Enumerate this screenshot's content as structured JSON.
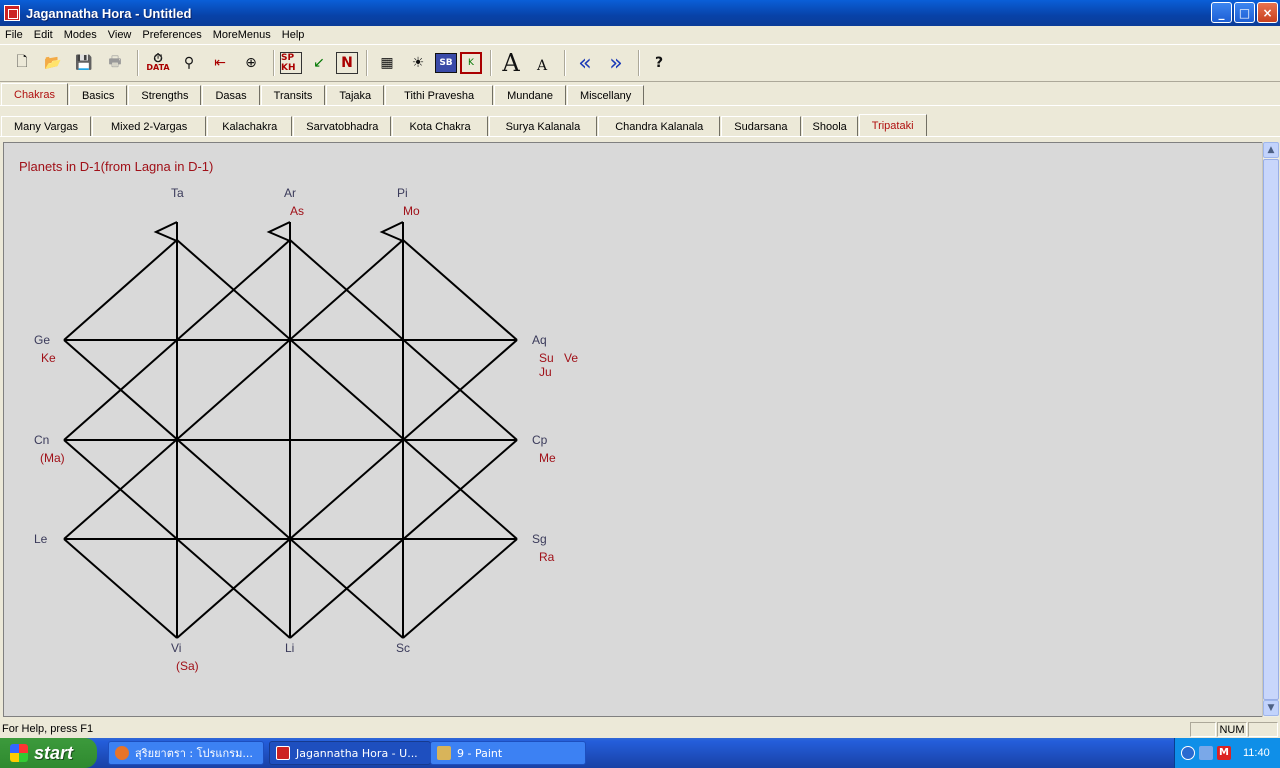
{
  "window": {
    "title": "Jagannatha Hora - Untitled"
  },
  "window_buttons": {
    "minimize": "_",
    "maximize": "□",
    "close": "×"
  },
  "menu": [
    "File",
    "Edit",
    "Modes",
    "View",
    "Preferences",
    "MoreMenus",
    "Help"
  ],
  "toolbar": {
    "new": "🗋",
    "open": "📂",
    "save": "💾",
    "print": "🖶",
    "data_label": "DATA",
    "sp_kh": "SP KH",
    "n_label": "N",
    "sb_label": "SB",
    "k_label": "K",
    "big_a": "A",
    "small_a": "A",
    "prev": "«",
    "next": "»",
    "help": "?"
  },
  "tabs_main": [
    {
      "label": "Chakras",
      "active": true
    },
    {
      "label": "Basics"
    },
    {
      "label": "Strengths"
    },
    {
      "label": "Dasas"
    },
    {
      "label": "Transits"
    },
    {
      "label": "Tajaka"
    },
    {
      "label": "Tithi Pravesha"
    },
    {
      "label": "Mundane"
    },
    {
      "label": "Miscellany"
    }
  ],
  "tabs_sub": [
    {
      "label": "Many Vargas"
    },
    {
      "label": "Mixed 2-Vargas"
    },
    {
      "label": "Kalachakra"
    },
    {
      "label": "Sarvatobhadra"
    },
    {
      "label": "Kota Chakra"
    },
    {
      "label": "Surya Kalanala"
    },
    {
      "label": "Chandra Kalanala"
    },
    {
      "label": "Sudarsana"
    },
    {
      "label": "Shoola"
    },
    {
      "label": "Tripataki",
      "active": true
    }
  ],
  "chart": {
    "title": "Planets in D-1(from Lagna in D-1)",
    "signs": {
      "ta": "Ta",
      "ar": "Ar",
      "pi": "Pi",
      "ge": "Ge",
      "cn": "Cn",
      "le": "Le",
      "aq": "Aq",
      "cp": "Cp",
      "sg": "Sg",
      "vi": "Vi",
      "li": "Li",
      "sc": "Sc"
    },
    "planets": {
      "ar_1": "As",
      "pi_1": "Mo",
      "ge_1": "Ke",
      "cn_1": "(Ma)",
      "aq_1": "Su",
      "aq_2": "Ve",
      "aq_3": "Ju",
      "cp_1": "Me",
      "sg_1": "Ra",
      "vi_1": "(Sa)"
    }
  },
  "status": {
    "help": "For Help, press F1",
    "num": "NUM"
  },
  "taskbar": {
    "start": "start",
    "tasks": [
      {
        "label": "สุริยยาตรา : โปรแกรม...",
        "icon_color": "#e8742a"
      },
      {
        "label": "Jagannatha Hora - U...",
        "icon_color": "#c22",
        "active": true
      },
      {
        "label": "9 - Paint",
        "icon_color": "#d8b45a"
      }
    ],
    "clock": "11:40"
  }
}
